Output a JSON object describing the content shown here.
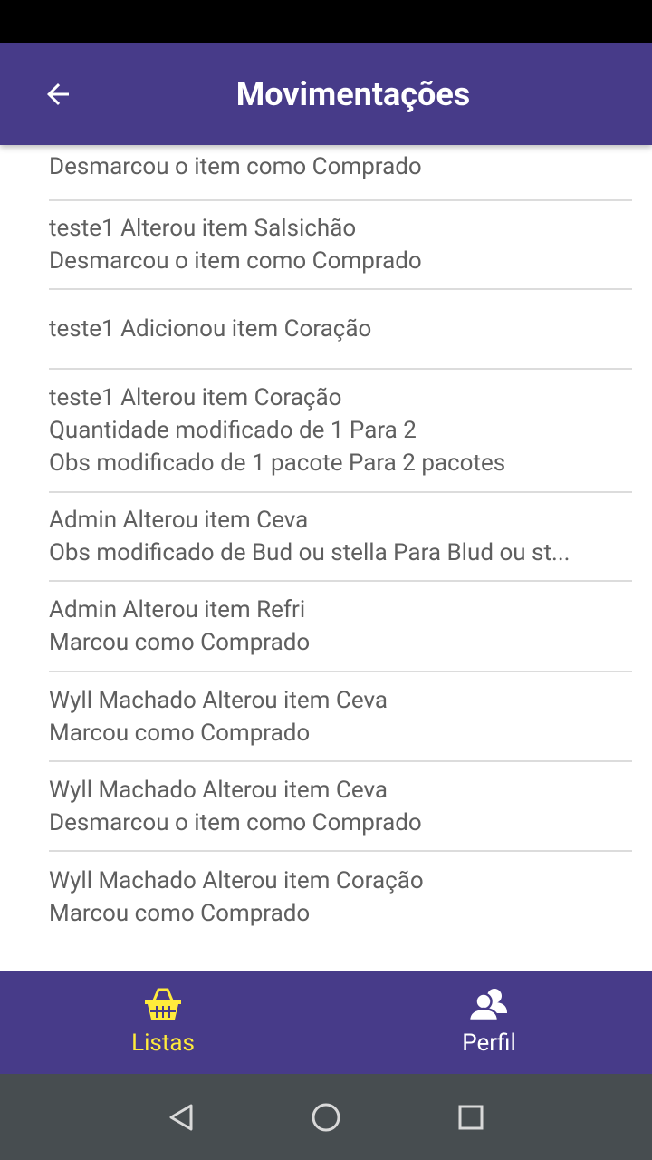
{
  "header": {
    "title": "Movimentações"
  },
  "items": [
    {
      "lines": [
        "Desmarcou o item como Comprado"
      ]
    },
    {
      "lines": [
        "teste1 Alterou item Salsichão",
        "Desmarcou o item como Comprado"
      ]
    },
    {
      "lines": [
        "teste1 Adicionou item Coração"
      ]
    },
    {
      "lines": [
        "teste1 Alterou item Coração",
        "Quantidade modificado de 1 Para 2",
        "Obs modificado de 1 pacote Para 2 pacotes"
      ]
    },
    {
      "lines": [
        "Admin Alterou item Ceva",
        "Obs modificado de Bud ou stella Para Blud ou st..."
      ]
    },
    {
      "lines": [
        "Admin Alterou item Refri",
        "Marcou como Comprado"
      ]
    },
    {
      "lines": [
        "Wyll Machado Alterou item Ceva",
        "Marcou como Comprado"
      ]
    },
    {
      "lines": [
        "Wyll Machado Alterou item Ceva",
        "Desmarcou o item como Comprado"
      ]
    },
    {
      "lines": [
        "Wyll Machado Alterou item Coração",
        "Marcou como Comprado"
      ]
    }
  ],
  "bottom_nav": {
    "tabs": [
      {
        "label": "Listas",
        "icon": "basket-icon",
        "active": true
      },
      {
        "label": "Perfil",
        "icon": "users-icon",
        "active": false
      }
    ]
  },
  "colors": {
    "primary": "#473b89",
    "active_tab": "#ffeb3b",
    "inactive_tab": "#ffffff",
    "text": "#5f5f5f",
    "divider": "#dcdcdc",
    "system_nav": "#474d50"
  }
}
